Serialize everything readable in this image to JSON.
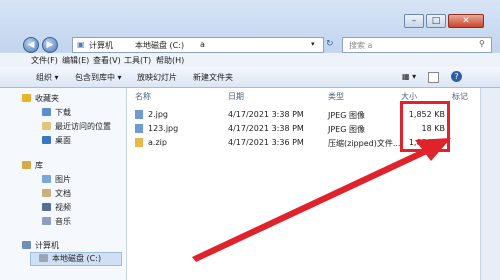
{
  "address": {
    "segments": [
      "计算机",
      "本地磁盘 (C:)",
      "a"
    ]
  },
  "search": {
    "placeholder": "搜索 a"
  },
  "menu": [
    "文件(F)",
    "编辑(E)",
    "查看(V)",
    "工具(T)",
    "帮助(H)"
  ],
  "toolbar": {
    "organize": "组织 ▾",
    "include": "包含到库中 ▾",
    "slideshow": "放映幻灯片",
    "new_folder": "新建文件夹"
  },
  "nav": {
    "favorites": "收藏夹",
    "fav_items": [
      "下载",
      "最近访问的位置",
      "桌面"
    ],
    "libraries": "库",
    "lib_items": [
      "图片",
      "文档",
      "视频",
      "音乐"
    ],
    "computer": "计算机",
    "drive": "本地磁盘 (C:)"
  },
  "columns": {
    "name": "名称",
    "date": "日期",
    "type": "类型",
    "size": "大小",
    "tags": "标记"
  },
  "files": [
    {
      "name": "2.jpg",
      "date": "4/17/2021 3:38 PM",
      "type": "JPEG 图像",
      "size": "1,852 KB"
    },
    {
      "name": "123.jpg",
      "date": "4/17/2021 3:38 PM",
      "type": "JPEG 图像",
      "size": "18 KB"
    },
    {
      "name": "a.zip",
      "date": "4/17/2021 3:36 PM",
      "type": "压缩(zipped)文件...",
      "size": "1,834 KB"
    }
  ],
  "colors": {
    "annotation": "#e0222b",
    "selection": "#cfe0f5"
  }
}
